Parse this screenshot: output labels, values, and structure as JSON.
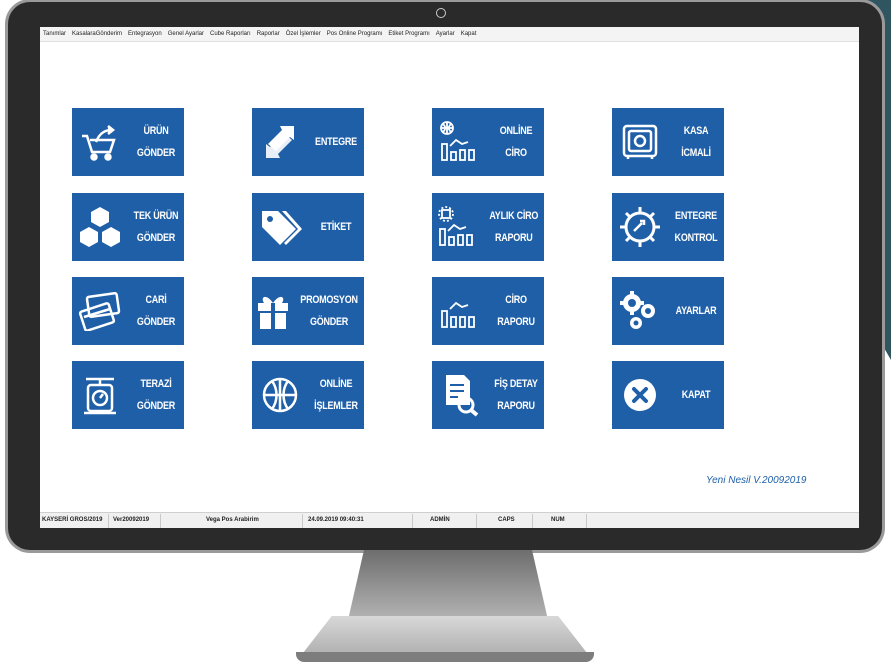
{
  "menu": [
    "Tanımlar",
    "KasalaraGönderim",
    "Entegrasyon",
    "Genel Ayarlar",
    "Cube Raporları",
    "Raporlar",
    "Özel İşlemler",
    "Pos Online Programı",
    "Etiket Programı",
    "Ayarlar",
    "Kapat"
  ],
  "tiles": [
    {
      "line1": "ÜRÜN",
      "line2": "GÖNDER",
      "icon": "cart-arrow-icon"
    },
    {
      "line1": "ENTEGRE",
      "line2": "",
      "icon": "sync-arrows-icon"
    },
    {
      "line1": "ONLİNE",
      "line2": "CİRO",
      "icon": "globe-chart-icon"
    },
    {
      "line1": "KASA",
      "line2": "İCMALİ",
      "icon": "safe-icon"
    },
    {
      "line1": "TEK ÜRÜN",
      "line2": "GÖNDER",
      "icon": "boxes-icon"
    },
    {
      "line1": "ETİKET",
      "line2": "",
      "icon": "tags-icon"
    },
    {
      "line1": "AYLIK CİRO",
      "line2": "RAPORU",
      "icon": "calendar-chart-icon"
    },
    {
      "line1": "ENTEGRE",
      "line2": "KONTROL",
      "icon": "gear-sync-icon"
    },
    {
      "line1": "CARİ",
      "line2": "GÖNDER",
      "icon": "cards-icon"
    },
    {
      "line1": "PROMOSYON",
      "line2": "GÖNDER",
      "icon": "gift-icon"
    },
    {
      "line1": "CİRO",
      "line2": "RAPORU",
      "icon": "bar-chart-icon"
    },
    {
      "line1": "AYARLAR",
      "line2": "",
      "icon": "gears-icon"
    },
    {
      "line1": "TERAZİ",
      "line2": "GÖNDER",
      "icon": "scale-icon"
    },
    {
      "line1": "ONLİNE",
      "line2": "İŞLEMLER",
      "icon": "globe-icon"
    },
    {
      "line1": "FİŞ DETAY",
      "line2": "RAPORU",
      "icon": "receipt-search-icon"
    },
    {
      "line1": "KAPAT",
      "line2": "",
      "icon": "close-circle-icon"
    }
  ],
  "version": "Yeni Nesil V.20092019",
  "status": {
    "branch": "KAYSERİ GROS/2019",
    "version": "Ver20092019",
    "interface": "Vega Pos Arabirim",
    "datetime": "24.09.2019 09:40:31",
    "user": "ADMİN",
    "caps": "CAPS",
    "num": "NUM"
  },
  "colors": {
    "tile": "#1f5fa8",
    "version_text": "#1f5fa8"
  }
}
